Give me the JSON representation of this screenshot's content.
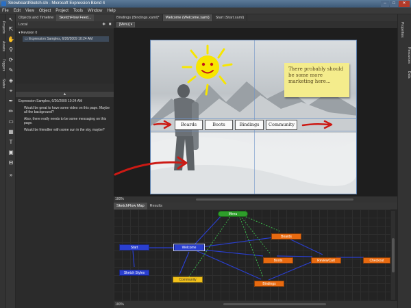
{
  "window": {
    "title": "SnowboardSketch.sln - Microsoft Expression Blend 4",
    "buttons": {
      "minimize": "–",
      "maximize": "□",
      "close": "✕"
    }
  },
  "menu": [
    "File",
    "Edit",
    "View",
    "Object",
    "Project",
    "Tools",
    "Window",
    "Help"
  ],
  "left_tabs": {
    "projects": "Projects",
    "assets": "Assets",
    "triggers": "Triggers",
    "states": "States"
  },
  "right_tabs": {
    "properties": "Properties",
    "resources": "Resources",
    "data": "Data"
  },
  "left_panel": {
    "tabs": [
      "Objects and Timeline",
      "SketchFlow Feed..."
    ],
    "local_label": "Local",
    "revision_label": "Revision 0",
    "entry": "Expression Samples, 6/26/2009 10:24 AM",
    "splitter_glyph": "▲",
    "feedback_header": "Expression Samples, 6/26/2009 10:24 AM",
    "feedback_items": [
      "Would be great to have some video on this page. Maybe all the background?",
      "Also, there really needs to be some messaging on this page.",
      "Would be friendlier with some sun in the sky, maybe?"
    ]
  },
  "document_tabs": [
    "Bindings (Bindings.xaml)*",
    "Welcome (Welcome.xaml)",
    "Start (Start.xaml)"
  ],
  "breadcrumb": "[Menu]",
  "artboard": {
    "sticky_note": "There probably should be some more marketing here...",
    "nav_buttons": [
      "Boards",
      "Boots",
      "Bindings",
      "Community"
    ],
    "zoom": "100%"
  },
  "bottom_panel": {
    "tabs": [
      "SketchFlow Map",
      "Results"
    ],
    "zoom": "100%",
    "nodes": {
      "menu": "Menu",
      "start": "Start",
      "welcome": "Welcome",
      "sketch_styles": "Sketch Styles",
      "community": "Community",
      "boards": "Boards",
      "boots": "Boots",
      "bindings": "Bindings",
      "reviewcart": "ReviewCart",
      "checkout": "Checkout"
    }
  },
  "colors": {
    "node_blue": "#2a3fd0",
    "node_orange": "#e86a10",
    "node_yellow": "#f2c11a",
    "node_green": "#2e9e2a",
    "sketch_red": "#cc1a14",
    "sun_yellow": "#f7e600"
  }
}
